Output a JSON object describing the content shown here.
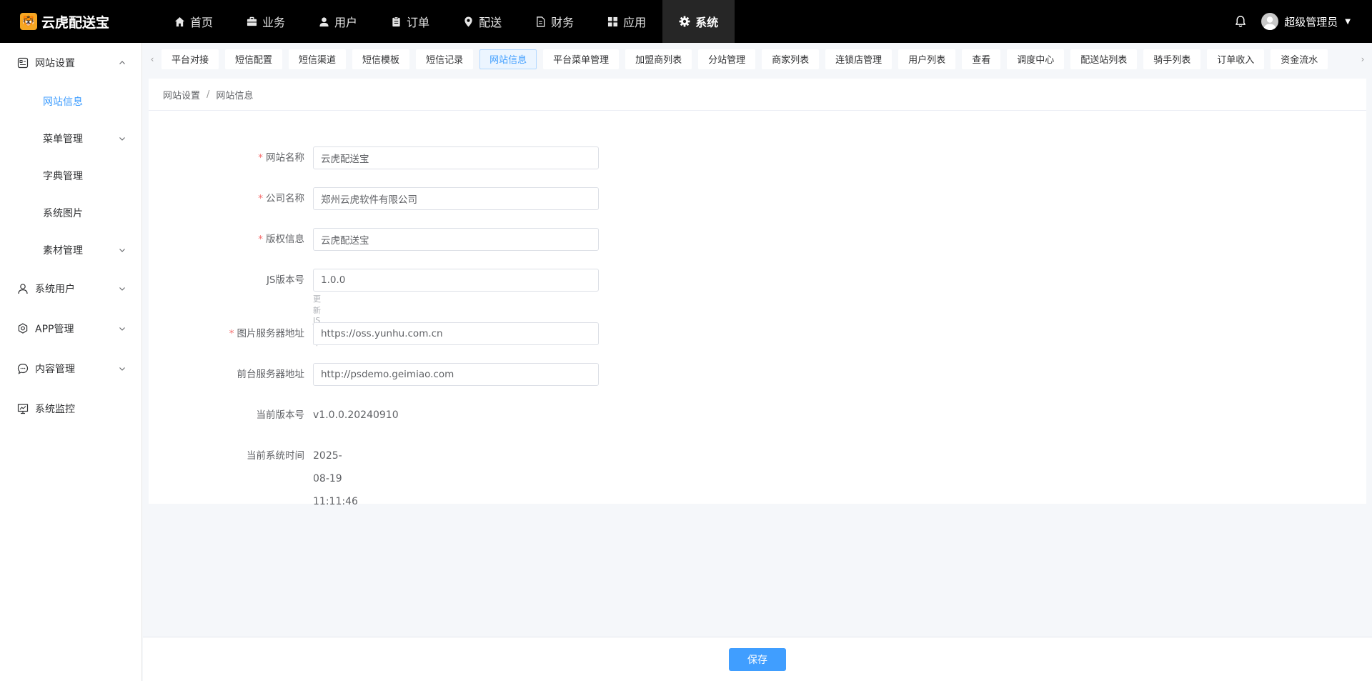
{
  "brand": {
    "name": "云虎配送宝"
  },
  "topnav": [
    {
      "label": "首页",
      "icon": "home-icon"
    },
    {
      "label": "业务",
      "icon": "briefcase-icon"
    },
    {
      "label": "用户",
      "icon": "user-icon"
    },
    {
      "label": "订单",
      "icon": "clipboard-icon"
    },
    {
      "label": "配送",
      "icon": "location-pin-icon"
    },
    {
      "label": "财务",
      "icon": "document-icon"
    },
    {
      "label": "应用",
      "icon": "grid-icon"
    },
    {
      "label": "系统",
      "icon": "gear-icon",
      "active": true
    }
  ],
  "user": {
    "name": "超级管理员"
  },
  "sidebar": {
    "groups": [
      {
        "label": "网站设置",
        "icon": "website-settings-icon",
        "expanded": true,
        "children": [
          {
            "label": "网站信息",
            "active": true
          },
          {
            "label": "菜单管理",
            "has_children": true
          },
          {
            "label": "字典管理"
          },
          {
            "label": "系统图片"
          },
          {
            "label": "素材管理",
            "has_children": true
          }
        ]
      },
      {
        "label": "系统用户",
        "icon": "user-outline-icon"
      },
      {
        "label": "APP管理",
        "icon": "cog-outline-icon"
      },
      {
        "label": "内容管理",
        "icon": "chat-bubble-icon"
      },
      {
        "label": "系统监控",
        "icon": "monitor-chart-icon"
      }
    ]
  },
  "tabs": [
    "平台对接",
    "短信配置",
    "短信渠道",
    "短信模板",
    "短信记录",
    "网站信息",
    "平台菜单管理",
    "加盟商列表",
    "分站管理",
    "商家列表",
    "连锁店管理",
    "用户列表",
    "查看",
    "调度中心",
    "配送站列表",
    "骑手列表",
    "订单收入",
    "资金流水"
  ],
  "active_tab": "网站信息",
  "breadcrumb": {
    "parent": "网站设置",
    "sep": "/",
    "current": "网站信息"
  },
  "form": {
    "site_name": {
      "label": "网站名称",
      "value": "云虎配送宝",
      "required": true
    },
    "company_name": {
      "label": "公司名称",
      "value": "郑州云虎软件有限公司",
      "required": true
    },
    "copyright": {
      "label": "版权信息",
      "value": "云虎配送宝",
      "required": true
    },
    "js_version": {
      "label": "JS版本号",
      "value": "1.0.0",
      "hint": "更新JS版本"
    },
    "image_server": {
      "label": "图片服务器地址",
      "value": "https://oss.yunhu.com.cn",
      "required": true
    },
    "frontend_server": {
      "label": "前台服务器地址",
      "value": "http://psdemo.geimiao.com"
    },
    "current_version": {
      "label": "当前版本号",
      "value": "v1.0.0.20240910"
    },
    "system_time": {
      "label": "当前系统时间",
      "value": "2025-08-19 11:11:46"
    }
  },
  "footer": {
    "save_label": "保存"
  },
  "colors": {
    "accent": "#409eff",
    "topbar": "#000000",
    "required": "#f56c6c"
  }
}
